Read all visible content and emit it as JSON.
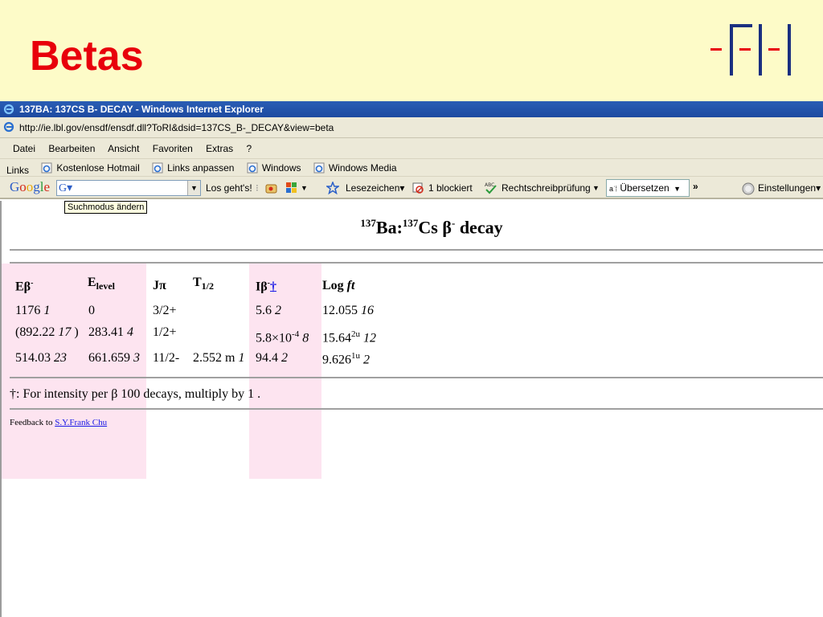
{
  "slide": {
    "title": "Betas",
    "accent_color": "#e8000b",
    "background": "#fdfbc8"
  },
  "browser": {
    "window_title": "137BA: 137CS B- DECAY - Windows Internet Explorer",
    "address": "http://ie.lbl.gov/ensdf/ensdf.dll?ToRI&dsid=137CS_B-_DECAY&view=beta",
    "menu": [
      "Datei",
      "Bearbeiten",
      "Ansicht",
      "Favoriten",
      "Extras",
      "?"
    ],
    "links_label": "Links",
    "links": [
      "Kostenlose Hotmail",
      "Links anpassen",
      "Windows",
      "Windows Media"
    ],
    "google": {
      "search_value": "",
      "search_button": "Los geht's!",
      "bookmarks": "Lesezeichen",
      "blocked": "1 blockiert",
      "spellcheck": "Rechtschreibprüfung",
      "translate": "Übersetzen",
      "more": "»",
      "settings": "Einstellungen",
      "tooltip": "Suchmodus ändern"
    }
  },
  "page": {
    "heading_sup1": "137",
    "heading_part1": "Ba:",
    "heading_sup2": "137",
    "heading_part2": "Cs β",
    "heading_sup3": "-",
    "heading_part3": " decay",
    "table": {
      "headers": {
        "e_beta": "Eβ",
        "e_beta_sup": "-",
        "e_level": "E",
        "e_level_sub": "level",
        "j_pi": "Jπ",
        "t_half": "T",
        "t_half_sub": "1/2",
        "i_beta": "Iβ",
        "i_beta_sup": "-",
        "i_beta_link": "†",
        "log_ft": "Log ",
        "log_ft_it": "ft"
      },
      "rows": [
        {
          "e_beta": "1176 ",
          "e_beta_unc": "1",
          "e_level": "0",
          "j_pi": "3/2+",
          "t_half": "",
          "t_half_unc": "",
          "i_beta": "5.6 ",
          "i_beta_unc": "2",
          "log_ft": "12.055 ",
          "log_ft_sup": "",
          "log_ft_unc": "16"
        },
        {
          "e_beta": "(892.22 ",
          "e_beta_unc": "17",
          "e_beta_close": " )",
          "e_level": "283.41 ",
          "e_level_unc": "4",
          "j_pi": "1/2+",
          "t_half": "",
          "t_half_unc": "",
          "i_beta": "5.8×10",
          "i_beta_exp": "-4",
          "i_beta_unc": " 8",
          "log_ft": "15.64",
          "log_ft_sup": "2u",
          "log_ft_unc": " 12"
        },
        {
          "e_beta": "514.03 ",
          "e_beta_unc": "23",
          "e_level": "661.659 ",
          "e_level_unc": "3",
          "j_pi": "11/2-",
          "t_half": "2.552 m ",
          "t_half_unc": "1",
          "i_beta": "94.4 ",
          "i_beta_unc": "2",
          "log_ft": "9.626",
          "log_ft_sup": "1u",
          "log_ft_unc": " 2"
        }
      ]
    },
    "footnote": "†: For intensity per β 100 decays, multiply by 1 .",
    "feedback_label": "Feedback to ",
    "feedback_link": "S.Y.Frank Chu"
  }
}
